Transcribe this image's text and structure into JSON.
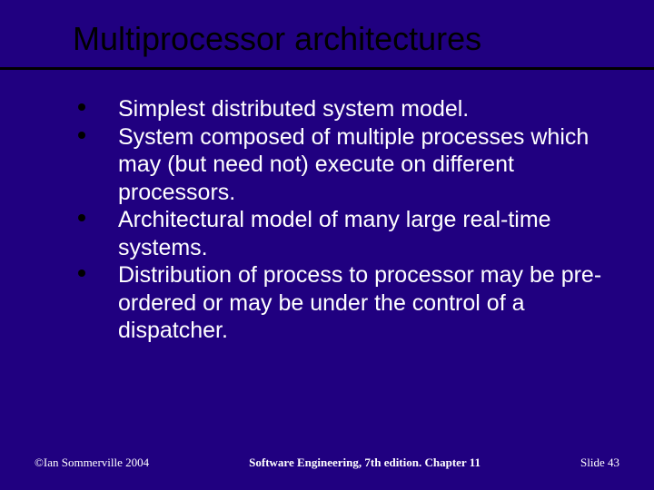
{
  "title": "Multiprocessor architectures",
  "bullets": [
    "Simplest distributed system model.",
    "System composed of multiple processes which may (but need not) execute on different processors.",
    "Architectural model of many large real-time systems.",
    "Distribution of process to processor may be pre-ordered or may be under the control of a dispatcher."
  ],
  "footer": {
    "left": "©Ian Sommerville 2004",
    "center": "Software Engineering, 7th edition. Chapter 11",
    "right_prefix": "Slide ",
    "slide_number": "43"
  }
}
